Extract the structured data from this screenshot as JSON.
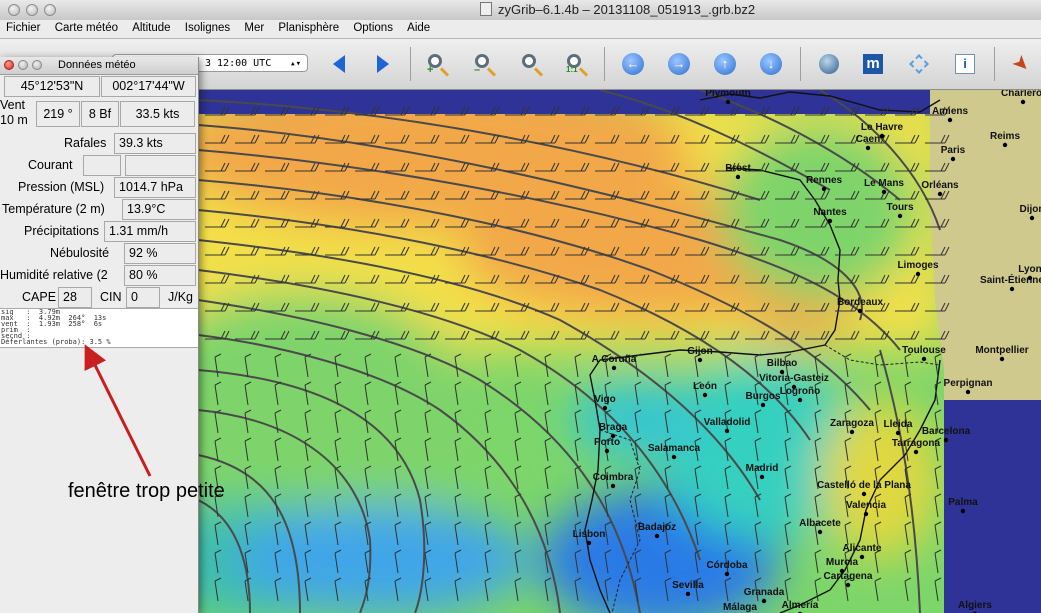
{
  "window": {
    "title": "zyGrib–6.1.4b – 20131108_051913_.grb.bz2"
  },
  "menu": [
    "Fichier",
    "Carte météo",
    "Altitude",
    "Isolignes",
    "Mer",
    "Planisphère",
    "Options",
    "Aide"
  ],
  "toolbar": {
    "date_text": "3 12:00 UTC",
    "icons": [
      "zoom-in-icon",
      "zoom-out-icon",
      "zoom-fit-icon",
      "zoom-11-icon",
      "arrow-left-icon",
      "arrow-right-icon",
      "arrow-up-icon",
      "arrow-down-icon",
      "globe-icon",
      "m-icon",
      "pointer-icon",
      "info-icon",
      "rocket-icon"
    ]
  },
  "panel": {
    "title": "Données météo",
    "lat": "45°12'53\"N",
    "lon": "002°17'44\"W",
    "wind_label_1": "Vent",
    "wind_label_2": "10 m",
    "wind_dir": "219 °",
    "wind_bf": "8 Bf",
    "wind_kts": "33.5  kts",
    "gust_label": "Rafales",
    "gust_value": "39.3  kts",
    "current_label": "Courant",
    "pressure_label": "Pression (MSL)",
    "pressure_value": "1014.7 hPa",
    "temp_label": "Température (2 m)",
    "temp_value": "13.9°C",
    "precip_label": "Précipitations",
    "precip_value": "1.31 mm/h",
    "cloud_label": "Nébulosité",
    "cloud_value": "92 %",
    "humid_label": "Humidité relative (2",
    "humid_value": "80 %",
    "cape_label": "CAPE",
    "cape_value": "28",
    "cin_label": "CIN",
    "cin_value": "0",
    "jkg": "J/Kg",
    "raw_lines": [
      "sig   :  3.79m",
      "max   :  4.92m  264°  13s",
      "vent  :  1.93m  258°  6s",
      "prim  :",
      "secnd :",
      "Déferlantes (proba): 3.5 %"
    ]
  },
  "annotation": {
    "text": "fenêtre trop petite"
  },
  "map": {
    "cities": [
      [
        "Plymouth",
        728,
        96
      ],
      [
        "Charleroi",
        1023,
        96
      ],
      [
        "Amiens",
        950,
        114
      ],
      [
        "Le Havre",
        882,
        130
      ],
      [
        "Caen",
        868,
        142
      ],
      [
        "Reims",
        1005,
        139
      ],
      [
        "Paris",
        953,
        153
      ],
      [
        "Brest",
        738,
        171
      ],
      [
        "Rennes",
        824,
        183
      ],
      [
        "Le Mans",
        884,
        186
      ],
      [
        "Orléans",
        940,
        188
      ],
      [
        "Dijon",
        1032,
        212
      ],
      [
        "Tours",
        900,
        210
      ],
      [
        "Nantes",
        830,
        215
      ],
      [
        "Limoges",
        918,
        268
      ],
      [
        "Lyon",
        1030,
        272
      ],
      [
        "Saint-Étienne",
        1012,
        283
      ],
      [
        "Bordeaux",
        860,
        305
      ],
      [
        "Toulouse",
        924,
        353
      ],
      [
        "Montpellier",
        1002,
        353
      ],
      [
        "A Coruña",
        614,
        362
      ],
      [
        "Gijon",
        700,
        354
      ],
      [
        "Bilbao",
        782,
        366
      ],
      [
        "Perpignan",
        968,
        386
      ],
      [
        "Vitoria-Gasteiz",
        794,
        381
      ],
      [
        "León",
        705,
        389
      ],
      [
        "Logroño",
        800,
        394
      ],
      [
        "Burgos",
        763,
        399
      ],
      [
        "Vigo",
        605,
        402
      ],
      [
        "Zaragoza",
        852,
        426
      ],
      [
        "Lleida",
        898,
        427
      ],
      [
        "Barcelona",
        946,
        434
      ],
      [
        "Braga",
        613,
        430
      ],
      [
        "Valladolid",
        727,
        425
      ],
      [
        "Tarragona",
        916,
        446
      ],
      [
        "Porto",
        607,
        445
      ],
      [
        "Salamanca",
        674,
        451
      ],
      [
        "Madrid",
        762,
        471
      ],
      [
        "Coimbra",
        613,
        480
      ],
      [
        "Castelló de la Plana",
        864,
        488
      ],
      [
        "Valencia",
        866,
        508
      ],
      [
        "Palma",
        963,
        505
      ],
      [
        "Badajoz",
        657,
        530
      ],
      [
        "Albacete",
        820,
        526
      ],
      [
        "Lisbon",
        589,
        537
      ],
      [
        "Alicante",
        862,
        551
      ],
      [
        "Murcia",
        842,
        565
      ],
      [
        "Cartagena",
        848,
        579
      ],
      [
        "Córdoba",
        727,
        568
      ],
      [
        "Sevilla",
        688,
        588
      ],
      [
        "Granada",
        764,
        595
      ],
      [
        "Almería",
        800,
        608
      ],
      [
        "Málaga",
        740,
        610
      ],
      [
        "Algiers",
        975,
        608
      ]
    ]
  }
}
